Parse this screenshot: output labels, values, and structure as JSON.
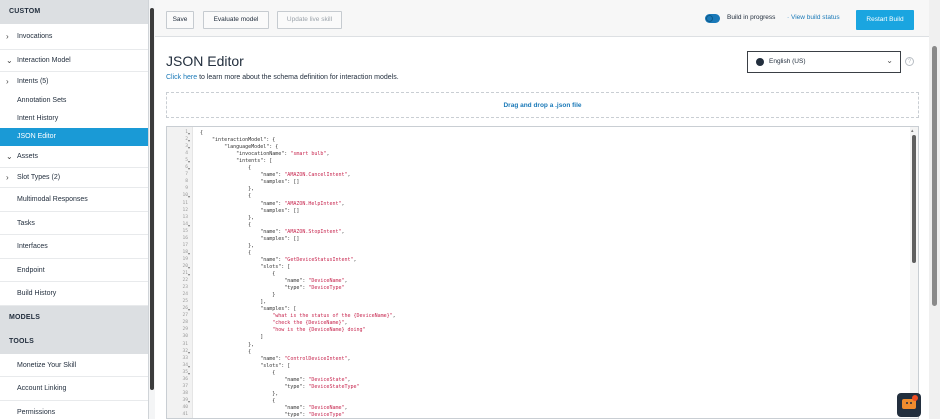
{
  "sidebar": {
    "custom_header": "CUSTOM",
    "models_header": "MODELS",
    "tools_header": "TOOLS",
    "items": {
      "invocations": "Invocations",
      "interaction_model": "Interaction Model",
      "intents": "Intents (5)",
      "annotation_sets": "Annotation Sets",
      "intent_history": "Intent History",
      "json_editor": "JSON Editor",
      "assets": "Assets",
      "slot_types": "Slot Types (2)",
      "multimodal_responses": "Multimodal Responses",
      "tasks": "Tasks",
      "interfaces": "Interfaces",
      "endpoint": "Endpoint",
      "build_history": "Build History",
      "monetize": "Monetize Your Skill",
      "account_linking": "Account Linking",
      "permissions": "Permissions"
    }
  },
  "toolbar": {
    "save_label": "Save",
    "evaluate_label": "Evaluate model",
    "update_label": "Update live skill",
    "build_status": "Build in progress",
    "view_status": "· View build status",
    "restart_label": "Restart Build"
  },
  "page": {
    "title": "JSON Editor",
    "link_text": "Click here",
    "subtitle_rest": " to learn more about the schema definition for interaction models.",
    "language": "English (US)",
    "help_glyph": "?",
    "dropzone": "Drag and drop a .json file"
  },
  "editor": {
    "lines": [
      [
        {
          "t": "{",
          "c": "k"
        }
      ],
      [
        {
          "t": "    \"interactionModel\": {",
          "c": "k"
        }
      ],
      [
        {
          "t": "        \"languageModel\": {",
          "c": "k"
        }
      ],
      [
        {
          "t": "            \"invocationName\": ",
          "c": "k"
        },
        {
          "t": "\"smart bulb\"",
          "c": "s"
        },
        {
          "t": ",",
          "c": "k"
        }
      ],
      [
        {
          "t": "            \"intents\": [",
          "c": "k"
        }
      ],
      [
        {
          "t": "                {",
          "c": "k"
        }
      ],
      [
        {
          "t": "                    \"name\": ",
          "c": "k"
        },
        {
          "t": "\"AMAZON.CancelIntent\"",
          "c": "s"
        },
        {
          "t": ",",
          "c": "k"
        }
      ],
      [
        {
          "t": "                    \"samples\": []",
          "c": "k"
        }
      ],
      [
        {
          "t": "                },",
          "c": "k"
        }
      ],
      [
        {
          "t": "                {",
          "c": "k"
        }
      ],
      [
        {
          "t": "                    \"name\": ",
          "c": "k"
        },
        {
          "t": "\"AMAZON.HelpIntent\"",
          "c": "s"
        },
        {
          "t": ",",
          "c": "k"
        }
      ],
      [
        {
          "t": "                    \"samples\": []",
          "c": "k"
        }
      ],
      [
        {
          "t": "                },",
          "c": "k"
        }
      ],
      [
        {
          "t": "                {",
          "c": "k"
        }
      ],
      [
        {
          "t": "                    \"name\": ",
          "c": "k"
        },
        {
          "t": "\"AMAZON.StopIntent\"",
          "c": "s"
        },
        {
          "t": ",",
          "c": "k"
        }
      ],
      [
        {
          "t": "                    \"samples\": []",
          "c": "k"
        }
      ],
      [
        {
          "t": "                },",
          "c": "k"
        }
      ],
      [
        {
          "t": "                {",
          "c": "k"
        }
      ],
      [
        {
          "t": "                    \"name\": ",
          "c": "k"
        },
        {
          "t": "\"GetDeviceStatusIntent\"",
          "c": "s"
        },
        {
          "t": ",",
          "c": "k"
        }
      ],
      [
        {
          "t": "                    \"slots\": [",
          "c": "k"
        }
      ],
      [
        {
          "t": "                        {",
          "c": "k"
        }
      ],
      [
        {
          "t": "                            \"name\": ",
          "c": "k"
        },
        {
          "t": "\"DeviceName\"",
          "c": "s"
        },
        {
          "t": ",",
          "c": "k"
        }
      ],
      [
        {
          "t": "                            \"type\": ",
          "c": "k"
        },
        {
          "t": "\"DeviceType\"",
          "c": "s"
        }
      ],
      [
        {
          "t": "                        }",
          "c": "k"
        }
      ],
      [
        {
          "t": "                    ],",
          "c": "k"
        }
      ],
      [
        {
          "t": "                    \"samples\": [",
          "c": "k"
        }
      ],
      [
        {
          "t": "                        ",
          "c": "k"
        },
        {
          "t": "\"what is the status of the {DeviceName}\"",
          "c": "s"
        },
        {
          "t": ",",
          "c": "k"
        }
      ],
      [
        {
          "t": "                        ",
          "c": "k"
        },
        {
          "t": "\"check the {DeviceName}\"",
          "c": "s"
        },
        {
          "t": ",",
          "c": "k"
        }
      ],
      [
        {
          "t": "                        ",
          "c": "k"
        },
        {
          "t": "\"how is the {DeviceName} doing\"",
          "c": "s"
        }
      ],
      [
        {
          "t": "                    ]",
          "c": "k"
        }
      ],
      [
        {
          "t": "                },",
          "c": "k"
        }
      ],
      [
        {
          "t": "                {",
          "c": "k"
        }
      ],
      [
        {
          "t": "                    \"name\": ",
          "c": "k"
        },
        {
          "t": "\"ControlDeviceIntent\"",
          "c": "s"
        },
        {
          "t": ",",
          "c": "k"
        }
      ],
      [
        {
          "t": "                    \"slots\": [",
          "c": "k"
        }
      ],
      [
        {
          "t": "                        {",
          "c": "k"
        }
      ],
      [
        {
          "t": "                            \"name\": ",
          "c": "k"
        },
        {
          "t": "\"DeviceState\"",
          "c": "s"
        },
        {
          "t": ",",
          "c": "k"
        }
      ],
      [
        {
          "t": "                            \"type\": ",
          "c": "k"
        },
        {
          "t": "\"DeviceStateType\"",
          "c": "s"
        }
      ],
      [
        {
          "t": "                        },",
          "c": "k"
        }
      ],
      [
        {
          "t": "                        {",
          "c": "k"
        }
      ],
      [
        {
          "t": "                            \"name\": ",
          "c": "k"
        },
        {
          "t": "\"DeviceName\"",
          "c": "s"
        },
        {
          "t": ",",
          "c": "k"
        }
      ],
      [
        {
          "t": "                            \"type\": ",
          "c": "k"
        },
        {
          "t": "\"DeviceType\"",
          "c": "s"
        }
      ],
      [
        {
          "t": "                        }",
          "c": "k"
        }
      ]
    ],
    "fold_lines": [
      1,
      2,
      3,
      5,
      6,
      10,
      14,
      18,
      20,
      21,
      26,
      32,
      34,
      35,
      39
    ]
  }
}
